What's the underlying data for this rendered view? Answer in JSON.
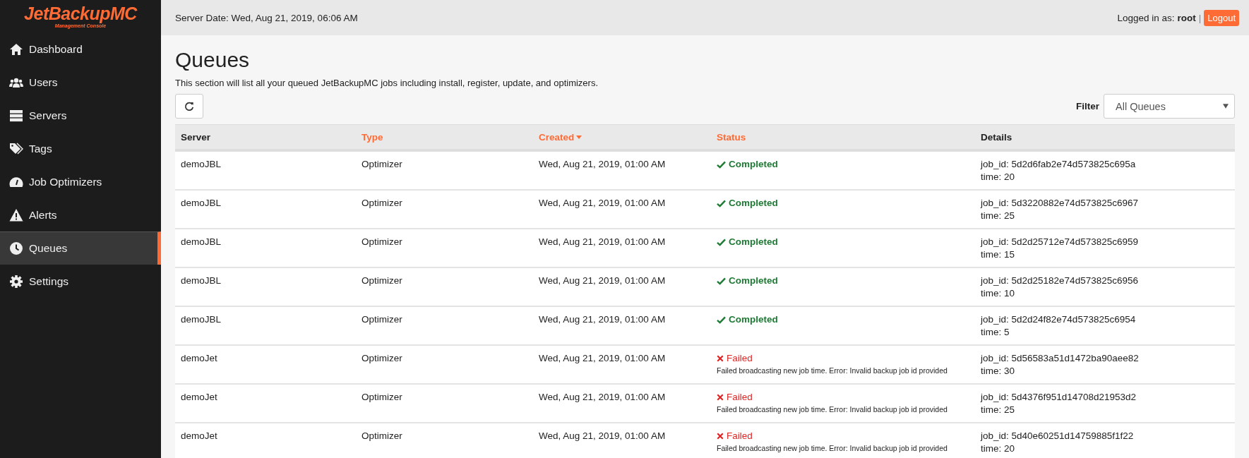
{
  "logo": {
    "name": "JetBackupMC",
    "subtitle": "Management Console"
  },
  "sidebar": {
    "items": [
      {
        "label": "Dashboard",
        "selected": false
      },
      {
        "label": "Users",
        "selected": false
      },
      {
        "label": "Servers",
        "selected": false
      },
      {
        "label": "Tags",
        "selected": false
      },
      {
        "label": "Job Optimizers",
        "selected": false
      },
      {
        "label": "Alerts",
        "selected": false
      },
      {
        "label": "Queues",
        "selected": true
      },
      {
        "label": "Settings",
        "selected": false
      }
    ]
  },
  "topbar": {
    "server_date": "Server Date: Wed, Aug 21, 2019, 06:06 AM",
    "logged_in_label": "Logged in as:",
    "user": "root",
    "separator": "|",
    "logout": "Logout"
  },
  "page": {
    "title": "Queues",
    "description": "This section will list all your queued JetBackupMC jobs including install, register, update, and optimizers."
  },
  "filter": {
    "label": "Filter",
    "value": "All Queues"
  },
  "table": {
    "columns": [
      {
        "label": "Server",
        "sortable": false,
        "sorted": false
      },
      {
        "label": "Type",
        "sortable": true,
        "sorted": false
      },
      {
        "label": "Created",
        "sortable": true,
        "sorted": true
      },
      {
        "label": "Status",
        "sortable": true,
        "sorted": false
      },
      {
        "label": "Details",
        "sortable": false,
        "sorted": false
      }
    ],
    "rows": [
      {
        "server": "demoJBL",
        "type": "Optimizer",
        "created": "Wed, Aug 21, 2019, 01:00 AM",
        "status": {
          "kind": "completed",
          "label": "Completed"
        },
        "details": [
          "job_id: 5d2d6fab2e74d573825c695a",
          "time: 20"
        ]
      },
      {
        "server": "demoJBL",
        "type": "Optimizer",
        "created": "Wed, Aug 21, 2019, 01:00 AM",
        "status": {
          "kind": "completed",
          "label": "Completed"
        },
        "details": [
          "job_id: 5d3220882e74d573825c6967",
          "time: 25"
        ]
      },
      {
        "server": "demoJBL",
        "type": "Optimizer",
        "created": "Wed, Aug 21, 2019, 01:00 AM",
        "status": {
          "kind": "completed",
          "label": "Completed"
        },
        "details": [
          "job_id: 5d2d25712e74d573825c6959",
          "time: 15"
        ]
      },
      {
        "server": "demoJBL",
        "type": "Optimizer",
        "created": "Wed, Aug 21, 2019, 01:00 AM",
        "status": {
          "kind": "completed",
          "label": "Completed"
        },
        "details": [
          "job_id: 5d2d25182e74d573825c6956",
          "time: 10"
        ]
      },
      {
        "server": "demoJBL",
        "type": "Optimizer",
        "created": "Wed, Aug 21, 2019, 01:00 AM",
        "status": {
          "kind": "completed",
          "label": "Completed"
        },
        "details": [
          "job_id: 5d2d24f82e74d573825c6954",
          "time: 5"
        ]
      },
      {
        "server": "demoJet",
        "type": "Optimizer",
        "created": "Wed, Aug 21, 2019, 01:00 AM",
        "status": {
          "kind": "failed",
          "label": "Failed",
          "message": "Failed broadcasting new job time. Error: Invalid backup job id provided"
        },
        "details": [
          "job_id: 5d56583a51d1472ba90aee82",
          "time: 30"
        ]
      },
      {
        "server": "demoJet",
        "type": "Optimizer",
        "created": "Wed, Aug 21, 2019, 01:00 AM",
        "status": {
          "kind": "failed",
          "label": "Failed",
          "message": "Failed broadcasting new job time. Error: Invalid backup job id provided"
        },
        "details": [
          "job_id: 5d4376f951d14708d21953d2",
          "time: 25"
        ]
      },
      {
        "server": "demoJet",
        "type": "Optimizer",
        "created": "Wed, Aug 21, 2019, 01:00 AM",
        "status": {
          "kind": "failed",
          "label": "Failed",
          "message": "Failed broadcasting new job time. Error: Invalid backup job id provided"
        },
        "details": [
          "job_id: 5d40e60251d14759885f1f22",
          "time: 20"
        ]
      }
    ]
  }
}
